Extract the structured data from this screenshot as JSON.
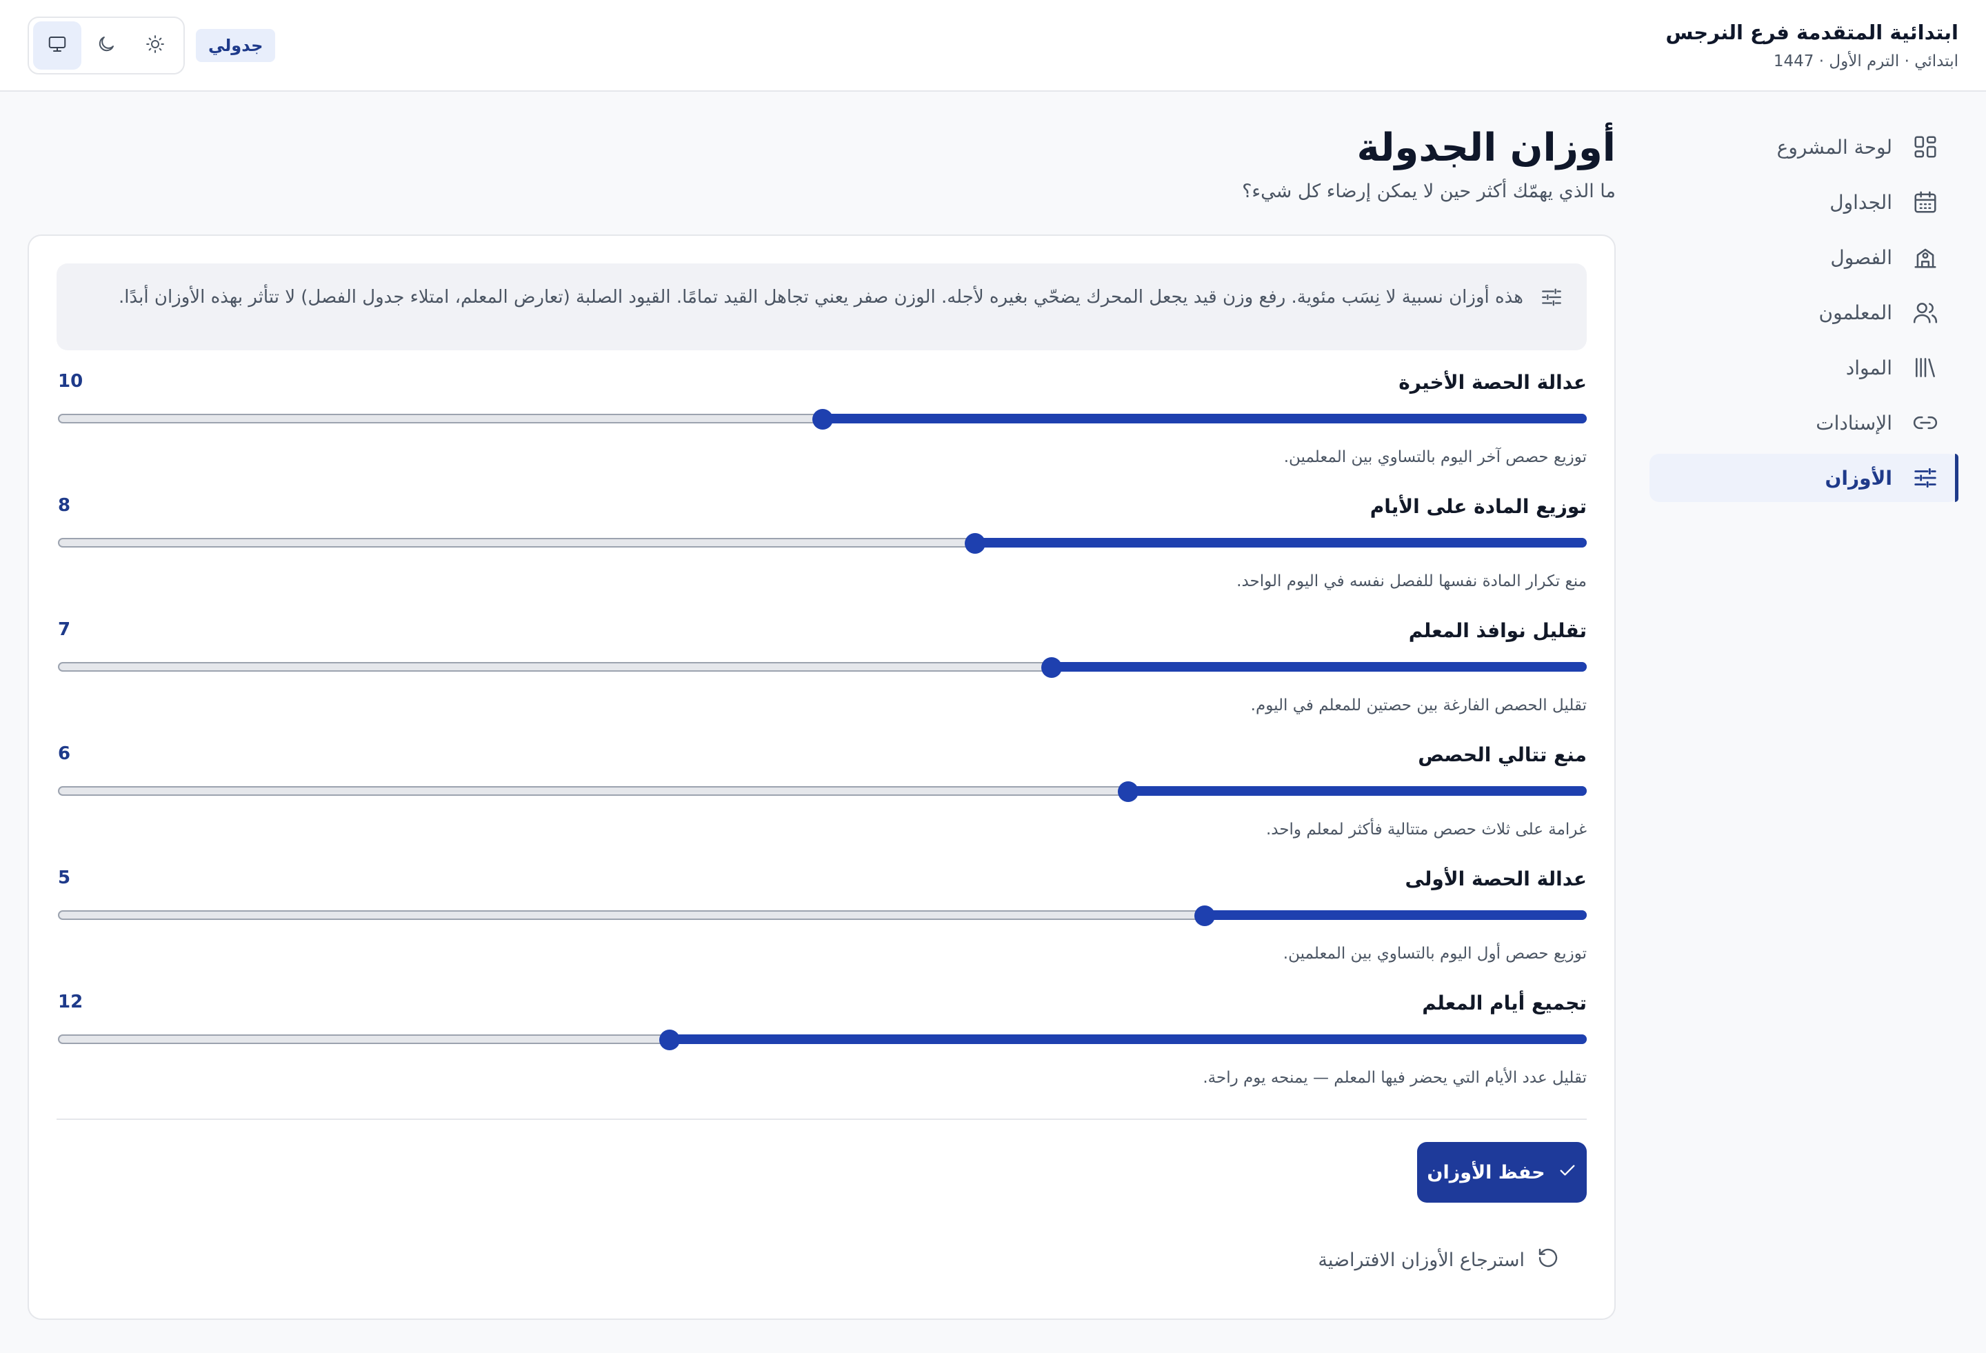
{
  "header": {
    "school_name": "ابتدائية المتقدمة فرع النرجس",
    "school_meta": "ابتدائي · الترم الأول · 1447",
    "app_badge": "جدولي"
  },
  "theme_toggle": {
    "options": [
      "system",
      "dark",
      "light"
    ],
    "selected": "system",
    "icons": [
      "monitor-icon",
      "moon-icon",
      "sun-icon"
    ]
  },
  "sidebar": {
    "items": [
      {
        "label": "لوحة المشروع",
        "icon": "dashboard-grid-icon",
        "active": false
      },
      {
        "label": "الجداول",
        "icon": "calendar-icon",
        "active": false
      },
      {
        "label": "الفصول",
        "icon": "school-building-icon",
        "active": false
      },
      {
        "label": "المعلمون",
        "icon": "users-icon",
        "active": false
      },
      {
        "label": "المواد",
        "icon": "library-books-icon",
        "active": false
      },
      {
        "label": "الإسنادات",
        "icon": "link-icon",
        "active": false
      },
      {
        "label": "الأوزان",
        "icon": "sliders-icon",
        "active": true
      }
    ]
  },
  "page": {
    "title": "أوزان الجدولة",
    "subtitle": "ما الذي يهمّك أكثر حين لا يمكن إرضاء كل شيء؟"
  },
  "info": {
    "icon": "sliders-icon",
    "text": "هذه أوزان نسبية لا نِسَب مئوية. رفع وزن قيد يجعل المحرك يضحّي بغيره لأجله. الوزن صفر يعني تجاهل القيد تمامًا. القيود الصلبة (تعارض المعلم، امتلاء جدول الفصل) لا تتأثر بهذه الأوزان أبدًا."
  },
  "slider_range": {
    "min": 0,
    "max": 20
  },
  "weights": [
    {
      "label": "عدالة الحصة الأخيرة",
      "value": 10,
      "description": "توزيع حصص آخر اليوم بالتساوي بين المعلمين."
    },
    {
      "label": "توزيع المادة على الأيام",
      "value": 8,
      "description": "منع تكرار المادة نفسها للفصل نفسه في اليوم الواحد."
    },
    {
      "label": "تقليل نوافذ المعلم",
      "value": 7,
      "description": "تقليل الحصص الفارغة بين حصتين للمعلم في اليوم."
    },
    {
      "label": "منع تتالي الحصص",
      "value": 6,
      "description": "غرامة على ثلاث حصص متتالية فأكثر لمعلم واحد."
    },
    {
      "label": "عدالة الحصة الأولى",
      "value": 5,
      "description": "توزيع حصص أول اليوم بالتساوي بين المعلمين."
    },
    {
      "label": "تجميع أيام المعلم",
      "value": 12,
      "description": "تقليل عدد الأيام التي يحضر فيها المعلم — يمنحه يوم راحة."
    }
  ],
  "actions": {
    "save_label": "حفظ الأوزان",
    "save_icon": "check-icon",
    "reset_label": "استرجاع الأوزان الافتراضية",
    "reset_icon": "rotate-ccw-icon"
  },
  "colors": {
    "accent": "#1e40af",
    "active_nav_bg": "#eef2fb",
    "badge_bg": "#e8eefb"
  }
}
